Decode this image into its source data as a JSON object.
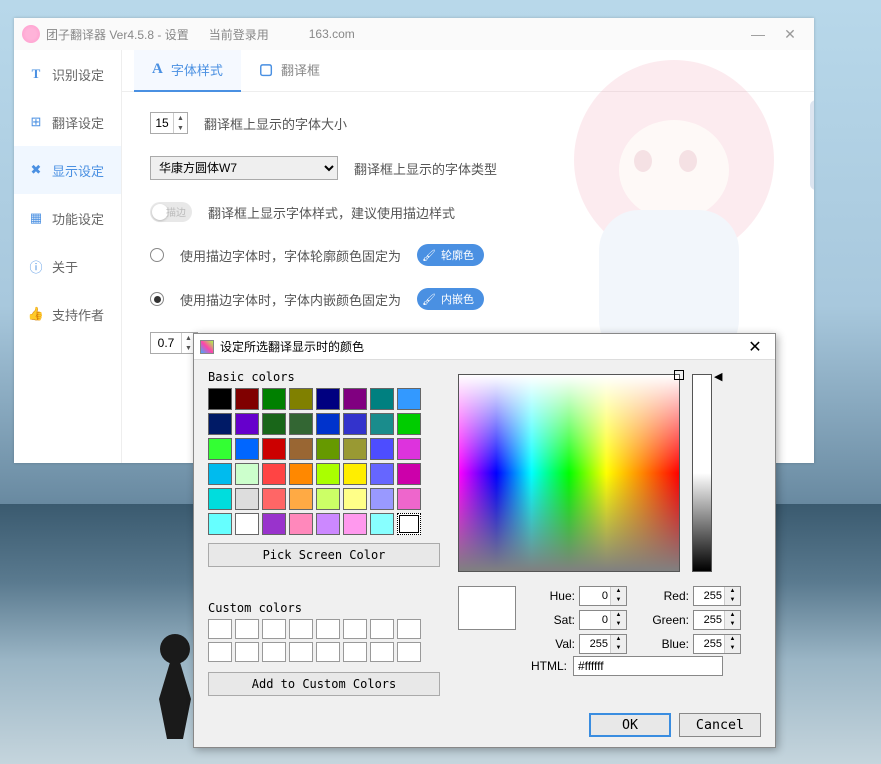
{
  "window": {
    "title": "团子翻译器 Ver4.5.8 - 设置",
    "user_label": "当前登录用",
    "user_domain": "163.com"
  },
  "sidebar": {
    "items": [
      {
        "icon": "T",
        "label": "识别设定",
        "color": "#4a90e2"
      },
      {
        "icon": "⊞",
        "label": "翻译设定",
        "color": "#4a90e2"
      },
      {
        "icon": "✕",
        "label": "显示设定",
        "color": "#4a90e2"
      },
      {
        "icon": "▦",
        "label": "功能设定",
        "color": "#4a90e2"
      },
      {
        "icon": "ⓘ",
        "label": "关于",
        "color": "#4a90e2"
      },
      {
        "icon": "👍",
        "label": "支持作者",
        "color": "#4a90e2"
      }
    ],
    "active_index": 2
  },
  "tabs": {
    "items": [
      {
        "icon": "A",
        "label": "字体样式"
      },
      {
        "icon": "▢",
        "label": "翻译框"
      }
    ],
    "active_index": 0
  },
  "settings": {
    "font_size_value": "15",
    "font_size_label": "翻译框上显示的字体大小",
    "font_family_value": "华康方圆体W7",
    "font_family_label": "翻译框上显示的字体类型",
    "outline_toggle_label": "描边",
    "outline_desc": "翻译框上显示字体样式，建议使用描边样式",
    "radio1_label": "使用描边字体时，字体轮廓颜色固定为",
    "radio1_pill": "轮廓色",
    "radio2_label": "使用描边字体时，字体内嵌颜色固定为",
    "radio2_pill": "内嵌色",
    "opacity_value": "0.7"
  },
  "color_dialog": {
    "title": "设定所选翻译显示时的颜色",
    "basic_label": "Basic colors",
    "pick_screen": "Pick Screen Color",
    "custom_label": "Custom colors",
    "add_custom": "Add to Custom Colors",
    "hue_label": "Hue:",
    "hue": "0",
    "sat_label": "Sat:",
    "sat": "0",
    "val_label": "Val:",
    "val": "255",
    "red_label": "Red:",
    "red": "255",
    "green_label": "Green:",
    "green": "255",
    "blue_label": "Blue:",
    "blue": "255",
    "html_label": "HTML:",
    "html_value": "#ffffff",
    "ok": "OK",
    "cancel": "Cancel",
    "basic_colors": [
      "#000000",
      "#800000",
      "#008000",
      "#808000",
      "#000080",
      "#800080",
      "#008080",
      "#3399ff",
      "#001a66",
      "#6600cc",
      "#196619",
      "#336633",
      "#0033cc",
      "#3333cc",
      "#1a8c8c",
      "#00cc00",
      "#33ff33",
      "#0066ff",
      "#cc0000",
      "#996633",
      "#669900",
      "#999933",
      "#4d4dff",
      "#dd33dd",
      "#00bbee",
      "#ccffcc",
      "#ff4444",
      "#ff8800",
      "#aaff00",
      "#ffee00",
      "#6666ff",
      "#cc00aa",
      "#00dddd",
      "#dddddd",
      "#ff6666",
      "#ffaa44",
      "#ccff66",
      "#ffff88",
      "#9999ff",
      "#ee66cc",
      "#66ffff",
      "#ffffff",
      "#9933cc",
      "#ff88bb",
      "#cc88ff",
      "#ff99ee",
      "#88ffff",
      "#ffffff"
    ],
    "selected_swatch_index": 47
  }
}
